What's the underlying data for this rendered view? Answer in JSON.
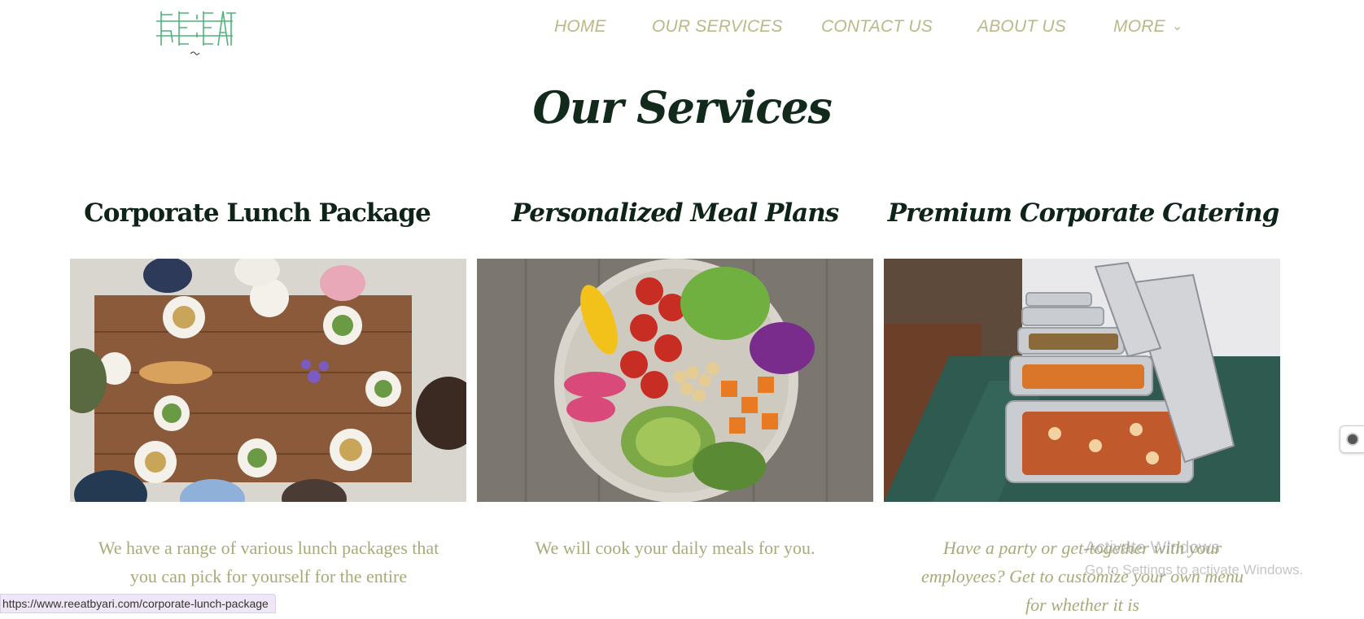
{
  "header": {
    "logo_text": "RE:EAT",
    "nav": [
      {
        "label": "HOME"
      },
      {
        "label": "OUR SERVICES"
      },
      {
        "label": "CONTACT US"
      },
      {
        "label": "ABOUT US"
      },
      {
        "label": "MORE"
      }
    ],
    "more_icon": "chevron-down-icon",
    "nav_color": "#b9ba86"
  },
  "main": {
    "title": "Our Services",
    "cards": [
      {
        "title": "Corporate Lunch Package",
        "description": "We have a range of various lunch packages that you can pick for yourself for the entire",
        "image": "group-lunch-table-photo"
      },
      {
        "title": "Personalized Meal Plans",
        "description": "We will cook your daily meals for you.",
        "image": "salad-bowl-photo"
      },
      {
        "title": "Premium Corporate Catering",
        "description": "Have a party or get-together with your employees? Get to customize your own menu for whether it is",
        "image": "buffet-chafing-dishes-photo"
      }
    ]
  },
  "overlay": {
    "watermark_title": "Activate Windows",
    "watermark_sub": "Go to Settings to activate Windows.",
    "status_url": "https://www.reeatbyari.com/corporate-lunch-package"
  },
  "colors": {
    "title": "#112a1c",
    "description": "#a8ab78",
    "logo": "#4fb37a"
  }
}
